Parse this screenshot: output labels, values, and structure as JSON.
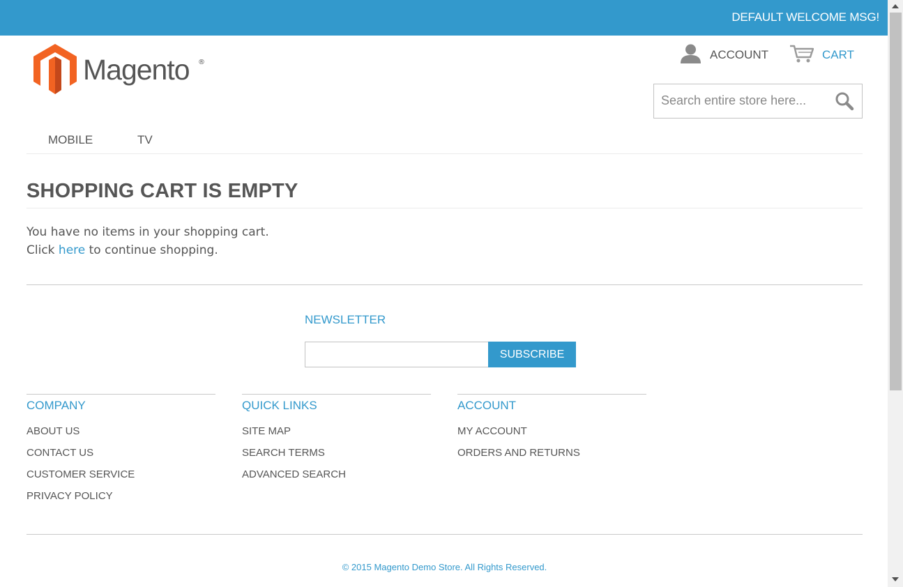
{
  "header": {
    "welcome": "DEFAULT WELCOME MSG!",
    "brand": "Magento",
    "brand_mark": "®",
    "account_label": "ACCOUNT",
    "cart_label": "CART",
    "search_placeholder": "Search entire store here...",
    "icons": {
      "account": "user-icon",
      "cart": "cart-icon",
      "search": "search-icon"
    }
  },
  "nav": {
    "items": [
      {
        "label": "MOBILE"
      },
      {
        "label": "TV"
      }
    ]
  },
  "main": {
    "title": "SHOPPING CART IS EMPTY",
    "message": "You have no items in your shopping cart.",
    "continue_prefix": "Click ",
    "continue_link": "here",
    "continue_suffix": " to continue shopping."
  },
  "footer": {
    "newsletter_title": "NEWSLETTER",
    "newsletter_value": "",
    "subscribe_label": "SUBSCRIBE",
    "columns": [
      {
        "title": "COMPANY",
        "links": [
          "ABOUT US",
          "CONTACT US",
          "CUSTOMER SERVICE",
          "PRIVACY POLICY"
        ]
      },
      {
        "title": "QUICK LINKS",
        "links": [
          "SITE MAP",
          "SEARCH TERMS",
          "ADVANCED SEARCH"
        ]
      },
      {
        "title": "ACCOUNT",
        "links": [
          "MY ACCOUNT",
          "ORDERS AND RETURNS"
        ]
      }
    ],
    "copyright": "© 2015 Magento Demo Store. All Rights Reserved."
  },
  "colors": {
    "accent": "#3399cc",
    "text": "#555555",
    "logo_orange": "#f26322"
  }
}
